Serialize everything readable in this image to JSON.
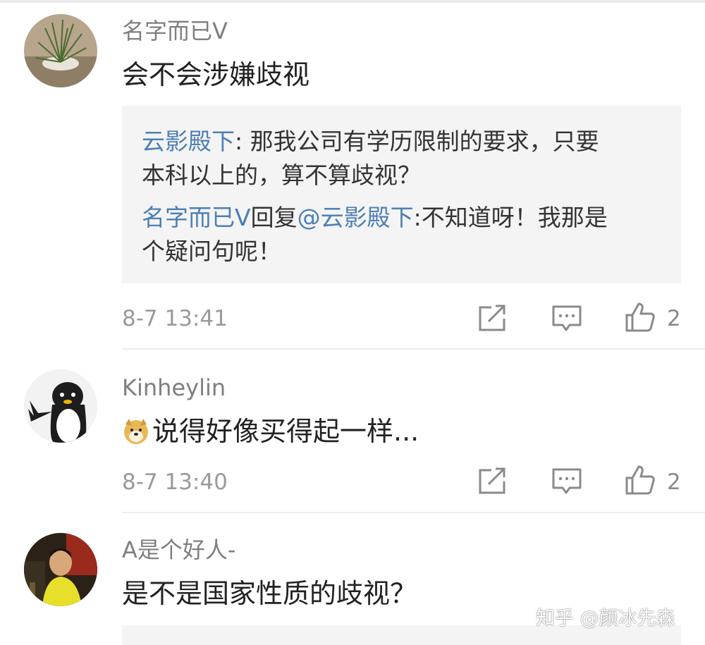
{
  "comments": [
    {
      "username": "名字而已V",
      "content": "会不会涉嫌歧视",
      "quote": {
        "line1_user": "云影殿下",
        "line1_sep": ": ",
        "line1_text": "那我公司有学历限制的要求，只要",
        "line2_text": "本科以上的，算不算歧视？",
        "line3_user": "名字而已V",
        "line3_reply_word": "回复",
        "line3_mention": "@云影殿下",
        "line3_text": ":不知道呀！我那是",
        "line4_text": "个疑问句呢！"
      },
      "time": "8-7 13:41",
      "likes": "2"
    },
    {
      "username": "Kinheylin",
      "emoji": "doge-emoji",
      "content": "说得好像买得起一样...",
      "time": "8-7 13:40",
      "likes": "2"
    },
    {
      "username": "A是个好人-",
      "content": "是不是国家性质的歧视？"
    }
  ],
  "icons": {
    "share": "share-icon",
    "reply": "comment-reply-icon",
    "like": "thumbs-up-icon"
  },
  "watermark": "知乎 @颜冰先森",
  "colors": {
    "link_blue": "#4d7fb4",
    "quote_bg": "#f4f4f4",
    "meta_gray": "#9a9a9a"
  }
}
